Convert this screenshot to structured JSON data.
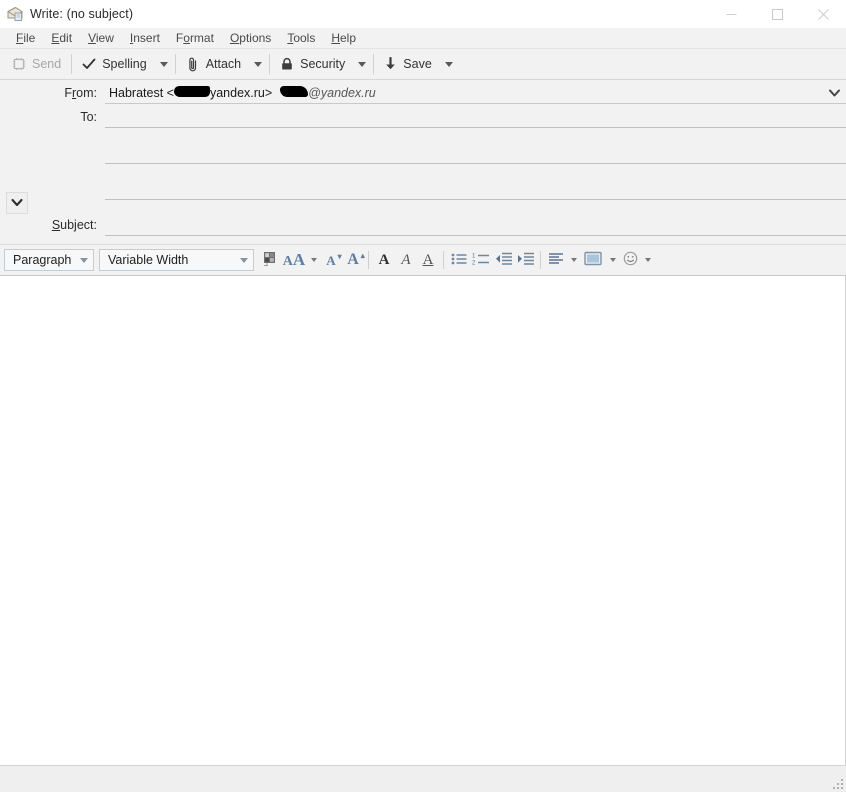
{
  "window": {
    "title": "Write: (no subject)",
    "icon": "compose-mail-icon",
    "controls": {
      "minimize": "minimize-icon",
      "maximize": "maximize-icon",
      "close": "close-icon"
    }
  },
  "menubar": {
    "items": [
      {
        "label": "File",
        "accesskey": "F"
      },
      {
        "label": "Edit",
        "accesskey": "E"
      },
      {
        "label": "View",
        "accesskey": "V"
      },
      {
        "label": "Insert",
        "accesskey": "I"
      },
      {
        "label": "Format",
        "accesskey": "o"
      },
      {
        "label": "Options",
        "accesskey": "O"
      },
      {
        "label": "Tools",
        "accesskey": "T"
      },
      {
        "label": "Help",
        "accesskey": "H"
      }
    ]
  },
  "toolbar": {
    "send": {
      "label": "Send",
      "icon": "send-icon",
      "disabled": true
    },
    "spelling": {
      "label": "Spelling",
      "icon": "checkmark-icon"
    },
    "attach": {
      "label": "Attach",
      "icon": "paperclip-icon"
    },
    "security": {
      "label": "Security",
      "icon": "lock-icon"
    },
    "save": {
      "label": "Save",
      "icon": "down-arrow-icon"
    },
    "dropdown_icon": "chevron-down-icon"
  },
  "headers": {
    "from": {
      "label": "From:",
      "accesskey": "r",
      "value_prefix": "Habratest <",
      "value_mid": "yandex.ru>",
      "value_suffix": "@yandex.ru",
      "redacted": true,
      "dropdown_icon": "chevron-down-icon"
    },
    "to": {
      "label": "To:",
      "value": "",
      "expand_icon": "chevron-down-icon",
      "extra_rows": 2
    },
    "subject": {
      "label": "Subject:",
      "accesskey": "S",
      "value": ""
    }
  },
  "format_toolbar": {
    "paragraph_select": {
      "value": "Paragraph",
      "options": [
        "Paragraph"
      ]
    },
    "font_select": {
      "value": "Variable Width",
      "options": [
        "Variable Width"
      ]
    },
    "buttons": [
      {
        "name": "text-color-swatch",
        "icon": "color-swatch-icon"
      },
      {
        "name": "font-color",
        "icon": "font-color-aa-icon",
        "has_dropdown": true
      },
      {
        "name": "decrease-font-size",
        "icon": "smaller-a-icon"
      },
      {
        "name": "increase-font-size",
        "icon": "larger-a-icon"
      },
      {
        "name": "bold",
        "icon": "bold-icon"
      },
      {
        "name": "italic",
        "icon": "italic-icon"
      },
      {
        "name": "underline",
        "icon": "underline-icon"
      },
      {
        "name": "bullet-list",
        "icon": "bullet-list-icon"
      },
      {
        "name": "numbered-list",
        "icon": "numbered-list-icon"
      },
      {
        "name": "outdent",
        "icon": "outdent-icon"
      },
      {
        "name": "indent",
        "icon": "indent-icon"
      },
      {
        "name": "align",
        "icon": "align-left-icon",
        "has_dropdown": true
      },
      {
        "name": "insert-image",
        "icon": "image-icon",
        "has_dropdown": true
      },
      {
        "name": "insert-smiley",
        "icon": "smiley-icon",
        "has_dropdown": true
      }
    ]
  },
  "compose_body": {
    "content": ""
  },
  "statusbar": {
    "text": "",
    "resize_grip": "resize-grip-icon"
  },
  "colors": {
    "window_bg": "#f2f2f2",
    "titlebar_bg": "#ffffff",
    "body_bg": "#ffffff",
    "field_underline": "#b9c2c9",
    "icon_blue": "#5b7fa6",
    "text": "#2b2b2b",
    "disabled_text": "#a6a6a6"
  }
}
